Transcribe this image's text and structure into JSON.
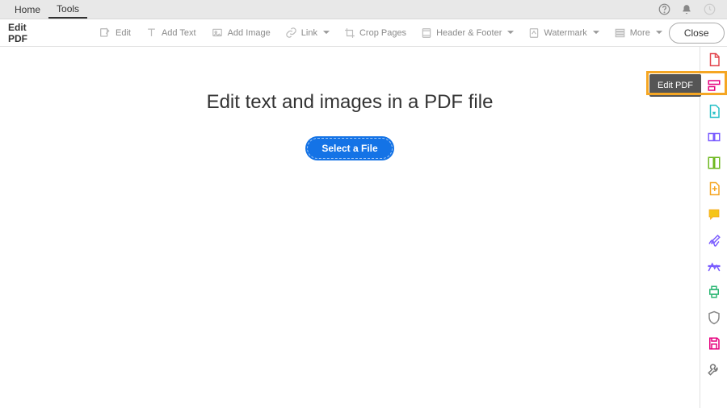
{
  "menubar": {
    "home": "Home",
    "tools": "Tools"
  },
  "toolbar": {
    "title": "Edit PDF",
    "edit": "Edit",
    "add_text": "Add Text",
    "add_image": "Add Image",
    "link": "Link",
    "crop": "Crop Pages",
    "header_footer": "Header & Footer",
    "watermark": "Watermark",
    "more": "More",
    "close": "Close"
  },
  "main": {
    "headline": "Edit text and images in a PDF file",
    "select_file": "Select a File"
  },
  "tooltip": {
    "label": "Edit PDF"
  },
  "rail_icons": [
    "create-pdf-icon",
    "edit-pdf-icon",
    "export-pdf-icon",
    "combine-icon",
    "organize-icon",
    "compress-icon",
    "comment-icon",
    "sign-icon",
    "redact-icon",
    "print-icon",
    "protect-icon",
    "save-icon",
    "tools-icon"
  ],
  "colors": {
    "accent_pink": "#e6007e",
    "primary_blue": "#1473e6",
    "highlight_orange": "#f5a623"
  }
}
